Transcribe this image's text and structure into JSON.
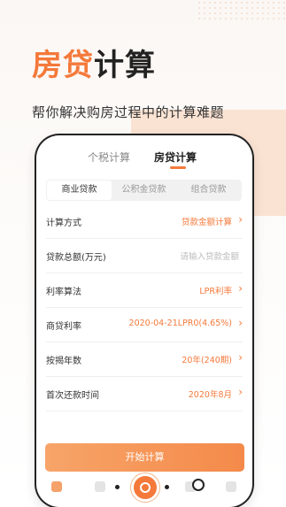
{
  "hero": {
    "title_accent": "房贷",
    "title_rest": "计算",
    "subtitle": "帮你解决购房过程中的计算难题"
  },
  "tabs": [
    {
      "label": "个税计算",
      "active": false
    },
    {
      "label": "房贷计算",
      "active": true
    }
  ],
  "loan_types": [
    {
      "label": "商业贷款",
      "active": true
    },
    {
      "label": "公积金贷款",
      "active": false
    },
    {
      "label": "组合贷款",
      "active": false
    }
  ],
  "form": {
    "calc_method": {
      "label": "计算方式",
      "value": "贷款金额计算"
    },
    "total_loan": {
      "label": "贷款总额(万元)",
      "placeholder": "请输入贷款金额"
    },
    "rate_method": {
      "label": "利率算法",
      "value": "LPR利率"
    },
    "commercial_rate": {
      "label": "商贷利率",
      "value": "2020-04-21LPR0(4.65%)"
    },
    "years": {
      "label": "按揭年数",
      "value": "20年(240期)"
    },
    "first_repay": {
      "label": "首次还款时间",
      "value": "2020年8月"
    }
  },
  "calc_button": "开始计算",
  "colors": {
    "accent": "#f4793a",
    "deco": "#fbe3d3"
  },
  "bottom_nav_icons": [
    "home-icon",
    "tool-icon",
    "calculator-fab-icon",
    "ring-icon",
    "profile-icon"
  ]
}
